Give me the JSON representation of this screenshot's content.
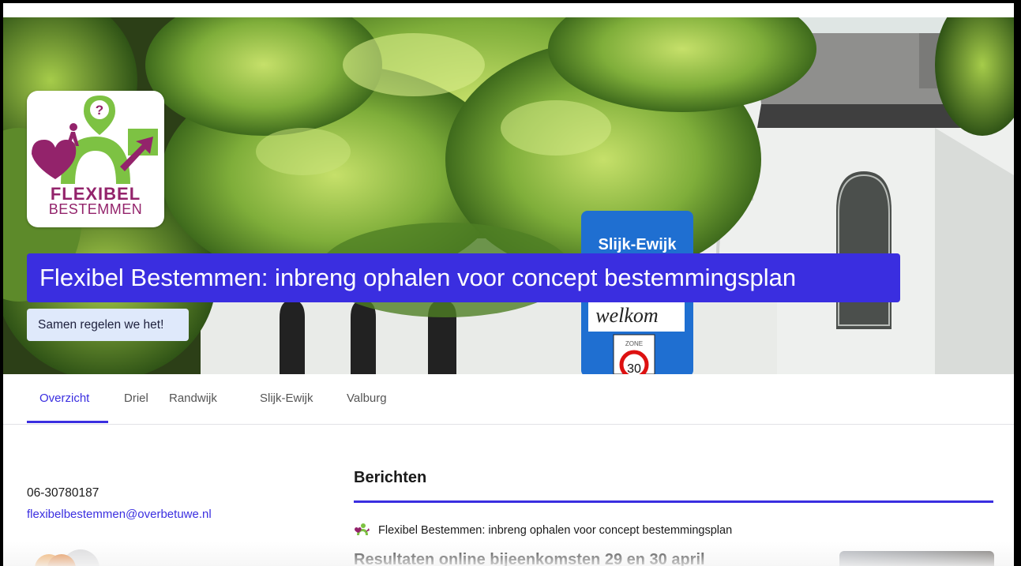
{
  "hero": {
    "logo_line1": "FLEXIBEL",
    "logo_line2": "BESTEMMEN",
    "logo_badge": "?",
    "title": "Flexibel Bestemmen: inbreng ophalen voor concept bestemmingsplan",
    "subtitle": "Samen regelen we het!",
    "sign": {
      "place": "Slijk-Ewijk",
      "welcome": "welkom",
      "zone_label": "ZONE",
      "speed": "30"
    }
  },
  "tabs": [
    {
      "label": "Overzicht",
      "active": true
    },
    {
      "label": "Driel",
      "active": false
    },
    {
      "label": "Randwijk",
      "active": false
    },
    {
      "label": "Slijk-Ewijk",
      "active": false
    },
    {
      "label": "Valburg",
      "active": false
    }
  ],
  "contact": {
    "phone": "06-30780187",
    "email": "flexibelbestemmen@overbetuwe.nl"
  },
  "berichten": {
    "heading": "Berichten",
    "source": "Flexibel Bestemmen: inbreng ophalen voor concept bestemmingsplan",
    "partial_title": "Resultaten online bijeenkomsten 29 en 30 april"
  },
  "colors": {
    "accent": "#3a2ee0",
    "logo_purple": "#93236b",
    "logo_green": "#7dc243",
    "subtitle_bg": "#dfe9fb"
  }
}
